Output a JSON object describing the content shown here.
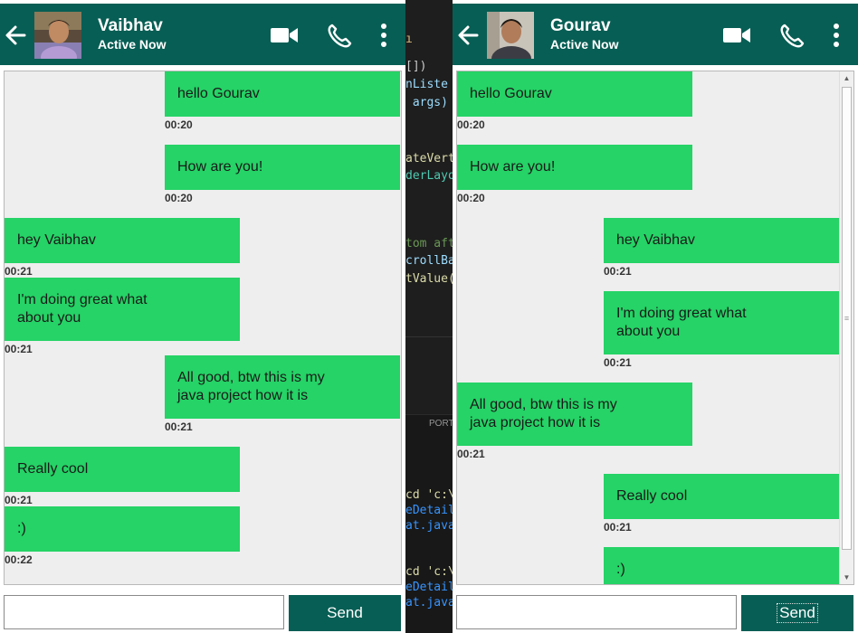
{
  "editor": {
    "lines": [
      {
        "text": "ı",
        "color": "#d7ba7d"
      },
      {
        "text": "[])",
        "color": "#cccccc"
      },
      {
        "text": "nListe",
        "color": "#9cdcfe"
      },
      {
        "text": " args)",
        "color": "#9cdcfe"
      },
      {
        "text": "ateVert",
        "color": "#dcdcaa"
      },
      {
        "text": "derLayo",
        "color": "#4ec9b0"
      },
      {
        "text": "tom aft",
        "color": "#6a9955"
      },
      {
        "text": "crollBa",
        "color": "#9cdcfe"
      },
      {
        "text": "tValue(",
        "color": "#dcdcaa"
      },
      {
        "text": "PORT",
        "color": "#969696"
      },
      {
        "text": "cd 'c:\\U",
        "color": "#dcdcaa"
      },
      {
        "text": "eDetails",
        "color": "#3794ff"
      },
      {
        "text": "at.java\\",
        "color": "#3794ff"
      },
      {
        "text": "cd 'c:\\U",
        "color": "#dcdcaa"
      },
      {
        "text": "eDetails",
        "color": "#3794ff"
      },
      {
        "text": "at.java\\",
        "color": "#3794ff"
      }
    ]
  },
  "windows": [
    {
      "contact_name": "Vaibhav",
      "status": "Active Now",
      "input_value": "",
      "send_label": "Send",
      "messages": [
        {
          "text": "hello Gourav",
          "time": "00:20",
          "side": "right"
        },
        {
          "text": "How are you!",
          "time": "00:20",
          "side": "right"
        },
        {
          "text": "hey Vaibhav",
          "time": "00:21",
          "side": "left"
        },
        {
          "text": "I'm doing great what about you",
          "time": "00:21",
          "side": "left"
        },
        {
          "text": "All good, btw this is my java project how it is",
          "time": "00:21",
          "side": "right"
        },
        {
          "text": "Really cool",
          "time": "00:21",
          "side": "left"
        },
        {
          "text": ":)",
          "time": "00:22",
          "side": "left"
        }
      ]
    },
    {
      "contact_name": "Gourav",
      "status": "Active Now",
      "input_value": "",
      "send_label": "Send",
      "messages": [
        {
          "text": "hello Gourav",
          "time": "00:20",
          "side": "left"
        },
        {
          "text": "How are you!",
          "time": "00:20",
          "side": "left"
        },
        {
          "text": "hey Vaibhav",
          "time": "00:21",
          "side": "right"
        },
        {
          "text": "I'm doing great what about you",
          "time": "00:21",
          "side": "right"
        },
        {
          "text": "All good, btw this is my java project how it is",
          "time": "00:21",
          "side": "left"
        },
        {
          "text": "Really cool",
          "time": "00:21",
          "side": "right"
        },
        {
          "text": ":)",
          "time": "",
          "side": "right"
        }
      ]
    }
  ],
  "colors": {
    "header": "#075e54",
    "bubble": "#25d366",
    "chat_bg": "#eeeeee"
  },
  "icons": [
    "back-arrow-icon",
    "video-call-icon",
    "phone-icon",
    "more-vert-icon"
  ]
}
